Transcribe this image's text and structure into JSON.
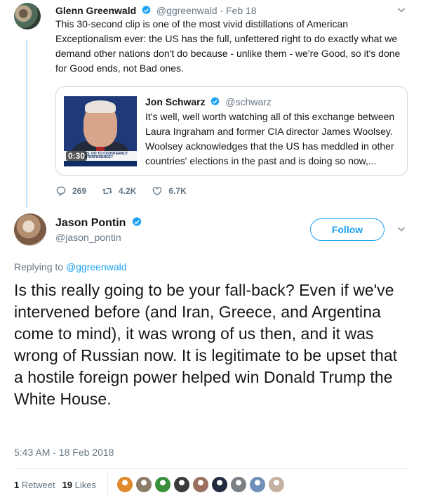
{
  "parent": {
    "name": "Glenn Greenwald",
    "handle": "@ggreenwald",
    "date": "Feb 18",
    "text": "This 30-second clip is one of the most vivid distillations of American Exceptionalism ever: the US has the full, unfettered right to do exactly what we demand other nations don't do because - unlike them - we're Good, so it's done for Good ends, not Bad ones.",
    "quote": {
      "name": "Jon Schwarz",
      "handle": "@schwarz",
      "text": "It's well, well worth watching all of this exchange between Laura Ingraham and former CIA director James Woolsey. Woolsey acknowledges that the US has meddled in other countries' elections in the past and is doing so now,...",
      "video_duration": "0:30",
      "chyron": "U.S. DO TO COUNTERACT INTERFERENCE?"
    },
    "replies": "269",
    "retweets": "4.2K",
    "likes": "6.7K"
  },
  "main": {
    "name": "Jason Pontin",
    "handle": "@jason_pontin",
    "follow_label": "Follow",
    "replying_prefix": "Replying to ",
    "replying_handle": "@ggreenwald",
    "text": "Is this really going to be your fall-back? Even if we've intervened before (and Iran, Greece, and Argentina come to mind), it was wrong of us then, and it was wrong of Russian now. It is legitimate to be upset that a hostile foreign power helped win Donald Trump the White House.",
    "timestamp": "5:43 AM - 18 Feb 2018",
    "retweet_count": "1",
    "retweet_label": "Retweet",
    "like_count": "19",
    "like_label": "Likes"
  },
  "colors": {
    "accent": "#1da1f2",
    "secondary_text": "#657786",
    "thread_line": "#c4e4f7"
  },
  "icons": [
    "verified-badge-icon",
    "chevron-down-icon",
    "reply-icon",
    "retweet-icon",
    "like-icon"
  ],
  "likers": [
    "#e08a2c",
    "#8c7d6a",
    "#3a8f3a",
    "#3b3b3b",
    "#9a6f5f",
    "#222b40",
    "#7b7f86",
    "#6e8fb7",
    "#c6b0a0"
  ]
}
